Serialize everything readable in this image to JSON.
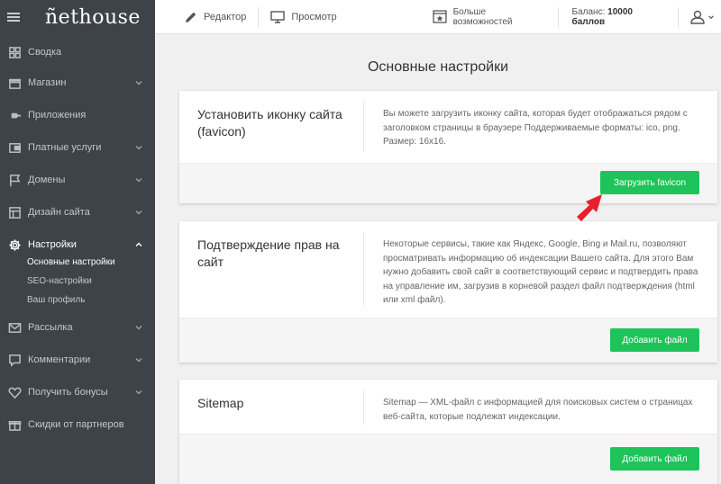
{
  "brand": {
    "logo": "ñethouse"
  },
  "sidebar": {
    "items": [
      {
        "label": "Сводка",
        "icon": "dashboard-icon"
      },
      {
        "label": "Магазин",
        "icon": "shop-icon"
      },
      {
        "label": "Приложения",
        "icon": "plugin-icon"
      },
      {
        "label": "Платные услуги",
        "icon": "wallet-icon"
      },
      {
        "label": "Домены",
        "icon": "flag-icon"
      },
      {
        "label": "Дизайн сайта",
        "icon": "layout-icon"
      },
      {
        "label": "Настройки",
        "icon": "gear-icon"
      },
      {
        "label": "Рассылка",
        "icon": "mail-icon"
      },
      {
        "label": "Комментарии",
        "icon": "comment-icon"
      },
      {
        "label": "Получить бонусы",
        "icon": "heart-icon"
      },
      {
        "label": "Скидки от партнеров",
        "icon": "gift-icon"
      }
    ],
    "settings_sub": [
      "Основные настройки",
      "SEO-настройки",
      "Ваш профиль"
    ]
  },
  "topbar": {
    "editor": "Редактор",
    "preview": "Просмотр",
    "more": "Больше возможностей",
    "balance_label": "Баланс:",
    "balance_value": "10000 баллов"
  },
  "main": {
    "title": "Основные настройки",
    "cards": [
      {
        "title": "Установить иконку сайта (favicon)",
        "desc": "Вы можете загрузить иконку сайта, которая будет отображаться рядом с заголовком страницы в браузере Поддерживаемые форматы: ico, png. Размер: 16x16.",
        "button": "Загрузить favicon"
      },
      {
        "title": "Подтверждение прав на сайт",
        "desc": "Некоторые сервисы, такие как Яндекс, Google, Bing и Mail.ru, позволяют просматривать информацию об индексации Вашего сайта. Для этого Вам нужно добавить свой сайт в соответствующий сервис и подтвердить права на управление им, загрузив в корневой раздел файл подтверждения (html или xml файл).",
        "button": "Добавить файл"
      },
      {
        "title": "Sitemap",
        "desc": "Sitemap — XML-файл с информацией для поисковых систем о страницах веб-сайта, которые подлежат индексации.",
        "button": "Добавить файл"
      }
    ]
  },
  "colors": {
    "sidebar_bg": "#3d4348",
    "accent_green": "#1ec45a",
    "arrow_red": "#e8202a"
  }
}
